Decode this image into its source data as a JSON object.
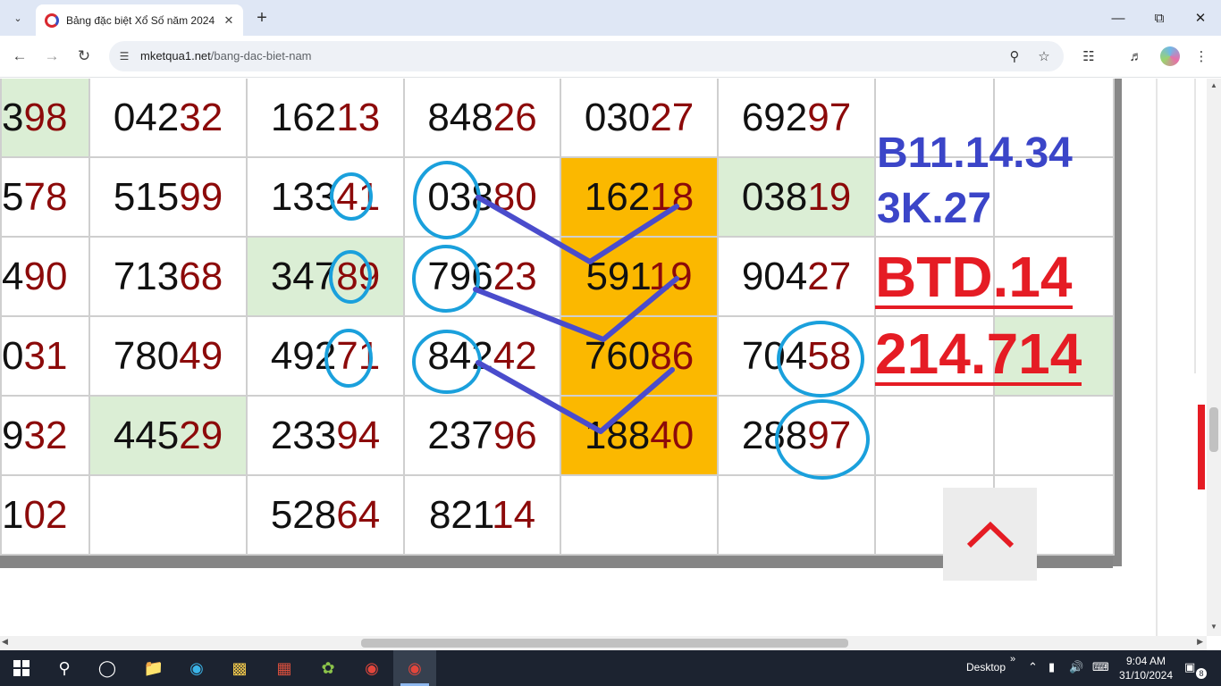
{
  "browser": {
    "tab_title": "Bảng đặc biệt Xổ Số năm 2024",
    "url_host": "mketqua1.net",
    "url_path": "/bang-dac-biet-nam"
  },
  "table": {
    "rows": [
      [
        {
          "head": "3",
          "tail": "98",
          "hl": "green"
        },
        {
          "head": "042",
          "tail": "32"
        },
        {
          "head": "162",
          "tail": "13"
        },
        {
          "head": "848",
          "tail": "26"
        },
        {
          "head": "030",
          "tail": "27"
        },
        {
          "head": "692",
          "tail": "97"
        }
      ],
      [
        {
          "head": "5",
          "tail": "78"
        },
        {
          "head": "515",
          "tail": "99"
        },
        {
          "head": "133",
          "tail": "41"
        },
        {
          "head": "038",
          "tail": "80"
        },
        {
          "head": "162",
          "tail": "18",
          "hl": "orange"
        },
        {
          "head": "038",
          "tail": "19",
          "hl": "green"
        }
      ],
      [
        {
          "head": "4",
          "tail": "90"
        },
        {
          "head": "713",
          "tail": "68"
        },
        {
          "head": "347",
          "tail": "89",
          "hl": "green"
        },
        {
          "head": "796",
          "tail": "23"
        },
        {
          "head": "591",
          "tail": "19",
          "hl": "orange"
        },
        {
          "head": "904",
          "tail": "27"
        }
      ],
      [
        {
          "head": "0",
          "tail": "31"
        },
        {
          "head": "780",
          "tail": "49"
        },
        {
          "head": "492",
          "tail": "71"
        },
        {
          "head": "842",
          "tail": "42"
        },
        {
          "head": "760",
          "tail": "86",
          "hl": "orange"
        },
        {
          "head": "704",
          "tail": "58"
        }
      ],
      [
        {
          "head": "9",
          "tail": "32"
        },
        {
          "head": "445",
          "tail": "29",
          "hl": "green"
        },
        {
          "head": "233",
          "tail": "94"
        },
        {
          "head": "237",
          "tail": "96"
        },
        {
          "head": "188",
          "tail": "40",
          "hl": "orange"
        },
        {
          "head": "288",
          "tail": "97"
        }
      ],
      [
        {
          "head": "1",
          "tail": "02"
        },
        {
          "head": "",
          "tail": ""
        },
        {
          "head": "528",
          "tail": "64"
        },
        {
          "head": "821",
          "tail": "14"
        },
        {
          "head": "",
          "tail": ""
        },
        {
          "head": "",
          "tail": ""
        }
      ]
    ]
  },
  "notes": {
    "line1": "B11.14.34",
    "line2": "3K.27",
    "line3": "BTD.14",
    "line4": "214.714"
  },
  "colors": {
    "blue_note": "#3b45c8",
    "red_note": "#e51c24",
    "circle": "#1aa0dc",
    "line": "#4a4ccc",
    "tail_digits": "#8c0a0a",
    "orange_cell": "#fbb800",
    "green_cell": "#dbeed5"
  },
  "taskbar": {
    "desktop_label": "Desktop",
    "time": "9:04 AM",
    "date": "31/10/2024",
    "notif_count": "8"
  }
}
